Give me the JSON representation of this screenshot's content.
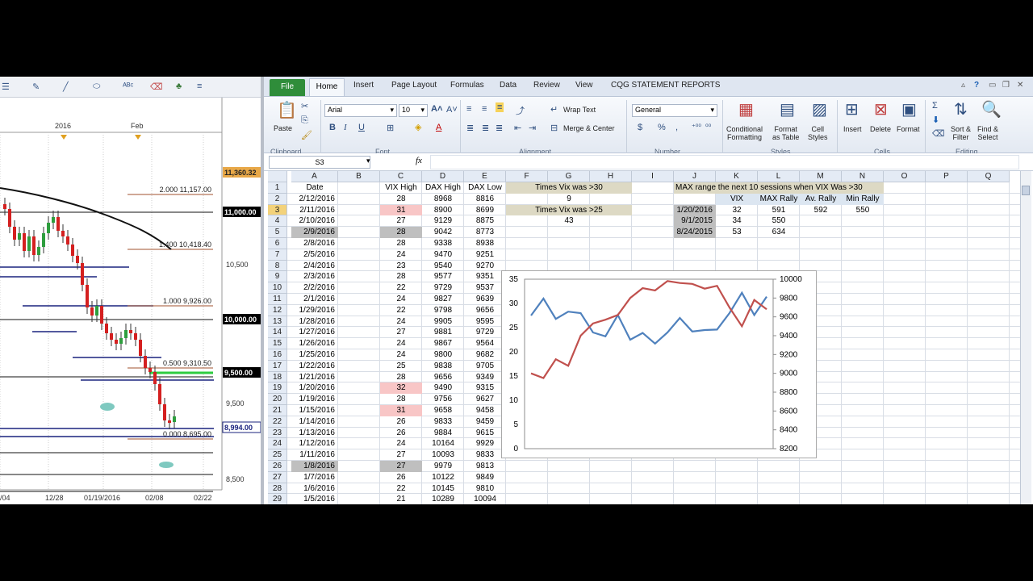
{
  "left_chart": {
    "x_labels": [
      "/04",
      "12/28",
      "01/19/2016",
      "02/08",
      "02/22"
    ],
    "top_labels": [
      "2016",
      "Feb"
    ],
    "y_labels": [
      "10,500",
      "9,500",
      "8,500"
    ],
    "price_badges": [
      "11,360.32",
      "11,000.00",
      "10,000.00",
      "9,500.00",
      "8,994.00"
    ],
    "fib": [
      "2.000  11,157.00",
      "1.400  10,418.40",
      "1.000  9,926.00",
      "0.500  9,310.50",
      "0.000  8,695.00"
    ]
  },
  "excel": {
    "tabs": [
      "File",
      "Home",
      "Insert",
      "Page Layout",
      "Formulas",
      "Data",
      "Review",
      "View",
      "CQG STATEMENT REPORTS"
    ],
    "font": "Arial",
    "size": "10",
    "format": "General",
    "labels": {
      "paste": "Paste",
      "wrap": "Wrap Text",
      "merge": "Merge & Center",
      "cond": "Conditional\nFormatting",
      "fmt_table": "Format\nas Table",
      "cell_styles": "Cell\nStyles",
      "insert": "Insert",
      "delete": "Delete",
      "format": "Format",
      "sort": "Sort &\nFilter",
      "find": "Find &\nSelect"
    },
    "groups": [
      "Clipboard",
      "Font",
      "Alignment",
      "Number",
      "Styles",
      "Cells",
      "Editing"
    ],
    "namebox": "S3",
    "fx": "fx"
  },
  "sheet": {
    "columns": [
      "A",
      "B",
      "C",
      "D",
      "E",
      "F",
      "G",
      "H",
      "I",
      "J",
      "K",
      "L",
      "M",
      "N",
      "O",
      "P",
      "Q"
    ],
    "header": [
      "Date",
      "VIX High",
      "DAX High",
      "DAX Low"
    ],
    "rows": [
      [
        "2/12/2016",
        "28",
        "8968",
        "8816"
      ],
      [
        "2/11/2016",
        "31",
        "8900",
        "8699"
      ],
      [
        "2/10/2016",
        "27",
        "9129",
        "8875"
      ],
      [
        "2/9/2016",
        "28",
        "9042",
        "8773"
      ],
      [
        "2/8/2016",
        "28",
        "9338",
        "8938"
      ],
      [
        "2/5/2016",
        "24",
        "9470",
        "9251"
      ],
      [
        "2/4/2016",
        "23",
        "9540",
        "9270"
      ],
      [
        "2/3/2016",
        "28",
        "9577",
        "9351"
      ],
      [
        "2/2/2016",
        "22",
        "9729",
        "9537"
      ],
      [
        "2/1/2016",
        "24",
        "9827",
        "9639"
      ],
      [
        "1/29/2016",
        "22",
        "9798",
        "9656"
      ],
      [
        "1/28/2016",
        "24",
        "9905",
        "9595"
      ],
      [
        "1/27/2016",
        "27",
        "9881",
        "9729"
      ],
      [
        "1/26/2016",
        "24",
        "9867",
        "9564"
      ],
      [
        "1/25/2016",
        "24",
        "9800",
        "9682"
      ],
      [
        "1/22/2016",
        "25",
        "9838",
        "9705"
      ],
      [
        "1/21/2016",
        "28",
        "9656",
        "9349"
      ],
      [
        "1/20/2016",
        "32",
        "9490",
        "9315"
      ],
      [
        "1/19/2016",
        "28",
        "9756",
        "9627"
      ],
      [
        "1/15/2016",
        "31",
        "9658",
        "9458"
      ],
      [
        "1/14/2016",
        "26",
        "9833",
        "9459"
      ],
      [
        "1/13/2016",
        "26",
        "9884",
        "9615"
      ],
      [
        "1/12/2016",
        "24",
        "10164",
        "9929"
      ],
      [
        "1/11/2016",
        "27",
        "10093",
        "9833"
      ],
      [
        "1/8/2016",
        "27",
        "9979",
        "9813"
      ],
      [
        "1/7/2016",
        "26",
        "10122",
        "9849"
      ],
      [
        "1/6/2016",
        "22",
        "10145",
        "9810"
      ],
      [
        "1/5/2016",
        "21",
        "10289",
        "10094"
      ]
    ],
    "times30_label": "Times Vix was >30",
    "times30": "9",
    "times25_label": "Times Vix was >25",
    "times25": "43",
    "max_title": "MAX range the next 10 sessions when VIX Was >30",
    "max_headers": [
      "VIX",
      "MAX Rally",
      "Av. Rally",
      "Min Rally"
    ],
    "max_rows": [
      [
        "1/20/2016",
        "32",
        "591"
      ],
      [
        "9/1/2015",
        "34",
        "550"
      ],
      [
        "8/24/2015",
        "53",
        "634"
      ]
    ],
    "av_rally": "592",
    "min_rally": "550"
  },
  "chart_data": {
    "type": "line",
    "title": "",
    "y_left_ticks": [
      "35",
      "30",
      "25",
      "20",
      "15",
      "10",
      "5",
      "0"
    ],
    "y_right_ticks": [
      "10000",
      "9800",
      "9600",
      "9400",
      "9200",
      "9000",
      "8800",
      "8600",
      "8400",
      "8200"
    ],
    "ylim_left": [
      0,
      35
    ],
    "ylim_right": [
      8200,
      10000
    ],
    "series": [
      {
        "name": "",
        "axis": "left",
        "color": "#4f81bd",
        "values": [
          27.5,
          31,
          26.8,
          28.3,
          28,
          24,
          23.2,
          27.6,
          22.5,
          23.9,
          21.7,
          24,
          27,
          24.2,
          24.5,
          24.6,
          28,
          32.2,
          27.6,
          31.4
        ]
      },
      {
        "name": "",
        "axis": "right",
        "color": "#c0504d",
        "values": [
          9000,
          8950,
          9150,
          9080,
          9400,
          9530,
          9570,
          9620,
          9800,
          9905,
          9881,
          9980,
          9960,
          9950,
          9900,
          9930,
          9700,
          9500,
          9780,
          9680
        ]
      }
    ]
  },
  "colors": {
    "ribbon": "#dfe6f1",
    "file_tab": "#2f8d3a",
    "vix_series": "#4f81bd",
    "dax_series": "#c0504d"
  }
}
